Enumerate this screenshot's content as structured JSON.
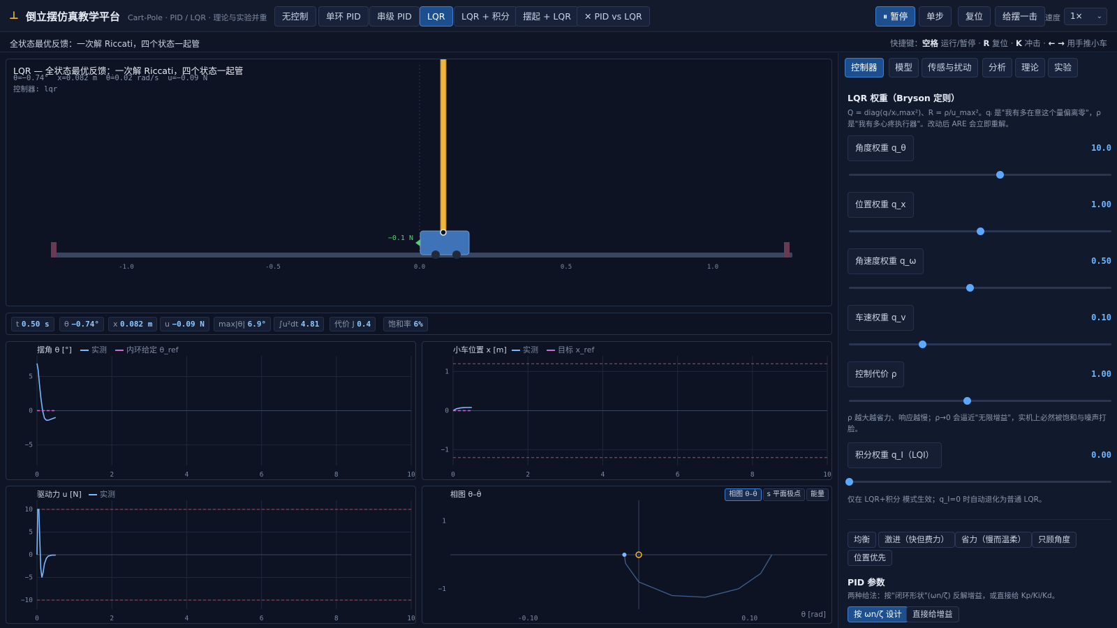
{
  "app": {
    "logo": "⊥",
    "title": "倒立摆仿真教学平台",
    "subtitle": "Cart-Pole · PID / LQR · 理论与实验并重"
  },
  "modes": [
    {
      "label": "无控制",
      "active": false
    },
    {
      "label": "单环 PID",
      "active": false
    },
    {
      "label": "串级 PID",
      "active": false
    },
    {
      "label": "LQR",
      "active": true
    },
    {
      "label": "LQR + 积分",
      "active": false
    },
    {
      "label": "摆起 + LQR",
      "active": false
    },
    {
      "label": "✕ PID vs LQR",
      "active": false
    }
  ],
  "controls": {
    "pause": "⏸ 暂停",
    "step": "单步",
    "reset": "复位",
    "kick": "给摆一击",
    "speed_label": "速度",
    "speed_value": "1×"
  },
  "subbar": {
    "left": "全状态最优反馈：一次解 Riccati，四个状态一起管",
    "hotkeys_label": "快捷键：",
    "k1": "空格",
    "k1_desc": " 运行/暂停 · ",
    "k2": "R",
    "k2_desc": " 复位 · ",
    "k3": "K",
    "k3_desc": " 冲击 · ",
    "k4": "← →",
    "k4_desc": " 用手推小车"
  },
  "sim": {
    "title": "LQR — 全状态最优反馈：一次解 Riccati，四个状态一起管",
    "state": "θ=−0.74°  x=0.082 m  θ̇=0.02 rad/s  u=−0.09 N",
    "controller": "控制器: lqr",
    "force_label": "−0.1 N",
    "axis_ticks": [
      "-1.0",
      "-0.5",
      "0.0",
      "0.5",
      "1.0"
    ],
    "cart_x": 0.082,
    "theta_deg": -0.74
  },
  "metrics": [
    {
      "label": "t",
      "value": "0.50 s"
    },
    {
      "label": "θ",
      "value": "−0.74°"
    },
    {
      "label": "x",
      "value": "0.082 m"
    },
    {
      "label": "u",
      "value": "−0.09 N"
    },
    {
      "label": "max|θ|",
      "value": "6.9°"
    },
    {
      "label": "∫u²dt",
      "value": "4.81"
    },
    {
      "label": "代价 J",
      "value": "0.4"
    },
    {
      "label": "饱和率",
      "value": "6%"
    }
  ],
  "plots": {
    "theta": {
      "title": "摆角 θ [°]",
      "leg1": "实测",
      "leg2": "内环给定 θ_ref"
    },
    "x": {
      "title": "小车位置 x [m]",
      "leg1": "实测",
      "leg2": "目标 x_ref"
    },
    "u": {
      "title": "驱动力 u [N]",
      "leg1": "实测"
    },
    "phase": {
      "title": "相图 θ–θ̇",
      "tab1": "相图 θ–θ̇",
      "tab2": "s 平面极点",
      "tab3": "能量",
      "axis_note": "θ [rad]"
    }
  },
  "colors": {
    "accent": "#1d4f8f",
    "series_measured": "#7ab8ff",
    "series_ref": "#d06ad0",
    "limit_line": "#b84a5a",
    "pole": "#f0b43a",
    "cart": "#3f73b8"
  },
  "chart_data": [
    {
      "type": "line",
      "title": "摆角 θ [°]",
      "xlim": [
        0,
        10
      ],
      "ylim": [
        -8,
        8
      ],
      "xticks": [
        "0",
        "2",
        "4",
        "6",
        "8",
        "10"
      ],
      "yticks": [
        "5",
        "0",
        "−5"
      ],
      "series": [
        {
          "name": "实测",
          "x": [
            0.0,
            0.03,
            0.06,
            0.1,
            0.15,
            0.2,
            0.25,
            0.3,
            0.35,
            0.4,
            0.45,
            0.5
          ],
          "values": [
            6.9,
            6.0,
            4.2,
            2.0,
            0.0,
            -1.1,
            -1.4,
            -1.4,
            -1.3,
            -1.2,
            -1.1,
            -1.0
          ]
        },
        {
          "name": "内环给定 θ_ref",
          "x": [
            0.0,
            0.5
          ],
          "values": [
            0,
            0
          ]
        }
      ]
    },
    {
      "type": "line",
      "title": "小车位置 x [m]",
      "xlim": [
        0,
        10
      ],
      "ylim": [
        -1.4,
        1.4
      ],
      "xticks": [
        "0",
        "2",
        "4",
        "6",
        "8",
        "10"
      ],
      "yticks": [
        "1",
        "0",
        "−1"
      ],
      "limits": [
        1.2,
        -1.2
      ],
      "series": [
        {
          "name": "实测",
          "x": [
            0.0,
            0.05,
            0.1,
            0.2,
            0.3,
            0.4,
            0.5
          ],
          "values": [
            0.0,
            0.03,
            0.05,
            0.07,
            0.078,
            0.081,
            0.082
          ]
        },
        {
          "name": "目标 x_ref",
          "x": [
            0.0,
            0.5
          ],
          "values": [
            0,
            0
          ]
        }
      ]
    },
    {
      "type": "line",
      "title": "驱动力 u [N]",
      "xlim": [
        0,
        10
      ],
      "ylim": [
        -12,
        12
      ],
      "xticks": [
        "0",
        "2",
        "4",
        "6",
        "8",
        "10"
      ],
      "yticks": [
        "10",
        "5",
        "0",
        "−5",
        "−10"
      ],
      "limits": [
        10,
        -10
      ],
      "series": [
        {
          "name": "实测",
          "x": [
            0.0,
            0.02,
            0.05,
            0.08,
            0.1,
            0.13,
            0.16,
            0.2,
            0.25,
            0.3,
            0.4,
            0.5
          ],
          "values": [
            0,
            10,
            10,
            2,
            -3,
            -5,
            -4,
            -2,
            -0.8,
            -0.3,
            -0.1,
            -0.09
          ]
        }
      ]
    },
    {
      "type": "scatter",
      "title": "相图 θ–θ̇",
      "xlabel": "θ [rad]",
      "xlim": [
        -0.17,
        0.17
      ],
      "ylim": [
        -1.6,
        1.6
      ],
      "xticks": [
        "-0.10",
        "0.10"
      ],
      "yticks": [
        "1",
        "−1"
      ],
      "trajectory": {
        "theta": [
          0.12,
          0.11,
          0.09,
          0.06,
          0.03,
          0.0,
          -0.012,
          -0.013
        ],
        "thetadot": [
          0.0,
          -0.55,
          -1.0,
          -1.25,
          -1.2,
          -0.8,
          -0.25,
          0.0
        ]
      },
      "current": {
        "theta": -0.013,
        "thetadot": 0.0
      },
      "target": {
        "theta": 0,
        "thetadot": 0
      }
    }
  ],
  "panel": {
    "tabs": [
      {
        "label": "控制器",
        "active": true
      },
      {
        "label": "模型",
        "active": false
      },
      {
        "label": "传感与扰动",
        "active": false
      },
      {
        "label": "分析",
        "active": false
      },
      {
        "label": "理论",
        "active": false
      },
      {
        "label": "实验",
        "active": false
      }
    ],
    "lqr_title": "LQR 权重（Bryson 定则）",
    "lqr_desc": "Q = diag(qᵢ/xᵢ,max²)、R = ρ/u_max²。qᵢ 是\"我有多在意这个量偏离零\"，ρ 是\"我有多心疼执行器\"。改动后 ARE 会立即重解。",
    "sliders": [
      {
        "label": "角度权重 q_θ",
        "value": "10.0",
        "pos": 0.575
      },
      {
        "label": "位置权重 q_x",
        "value": "1.00",
        "pos": 0.5
      },
      {
        "label": "角速度权重 q_ω",
        "value": "0.50",
        "pos": 0.46
      },
      {
        "label": "车速权重 q_v",
        "value": "0.10",
        "pos": 0.28
      },
      {
        "label": "控制代价 ρ",
        "value": "1.00",
        "pos": 0.45
      }
    ],
    "rho_note": "ρ 越大越省力、响应越慢；ρ→0 会逼近\"无限增益\"，实机上必然被饱和与噪声打脸。",
    "qi_slider": {
      "label": "积分权重 q_I（LQI）",
      "value": "0.00",
      "pos": 0.0
    },
    "qi_note": "仅在 LQR+积分 模式生效；q_I=0 时自动退化为普通 LQR。",
    "presets": [
      "均衡",
      "激进（快但费力）",
      "省力（慢而温柔）",
      "只顾角度",
      "位置优先"
    ],
    "pid_title": "PID 参数",
    "pid_desc": "两种给法：按\"闭环形状\"(ωn/ζ) 反解增益，或直接给 Kp/Ki/Kd。",
    "pid_modes": [
      {
        "label": "按 ωn/ζ 设计",
        "active": true
      },
      {
        "label": "直接给增益",
        "active": false
      }
    ]
  }
}
